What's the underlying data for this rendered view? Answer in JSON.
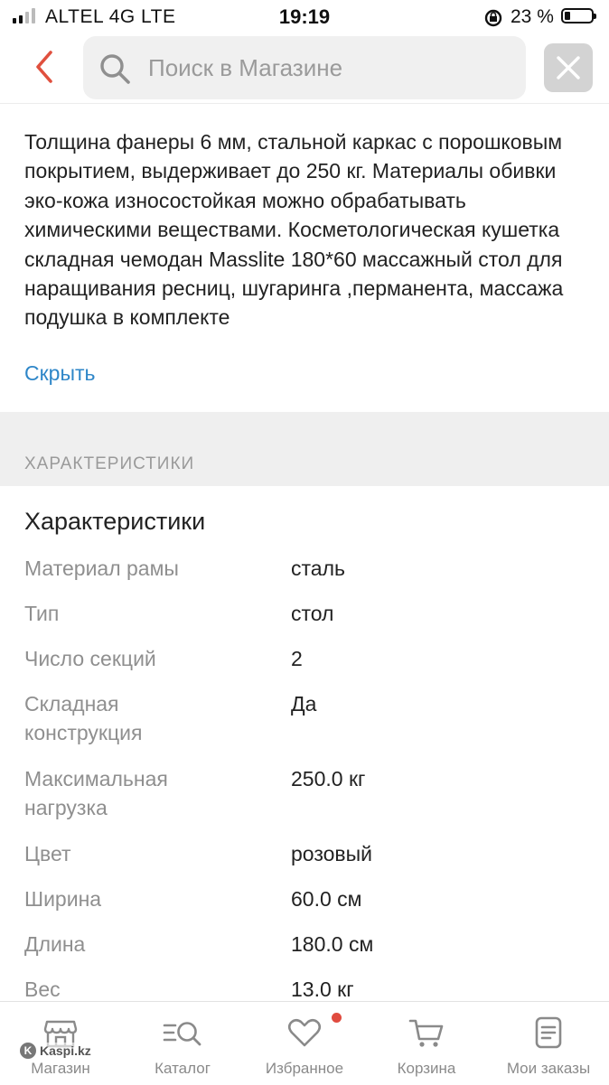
{
  "status_bar": {
    "carrier": "ALTEL 4G  LTE",
    "time": "19:19",
    "battery_percent": "23 %",
    "battery_level": 0.23
  },
  "header": {
    "search_placeholder": "Поиск в Магазине"
  },
  "description": {
    "text": "Толщина фанеры 6 мм, стальной каркас с порошковым покрытием, выдерживает до 250 кг. Материалы обивки эко-кожа износостойкая можно обрабатывать химическими веществами. Косметологическая кушетка складная чемодан Masslite 180*60 массажный стол для наращивания ресниц, шугаринга ,перманента, массажа подушка в комплекте",
    "hide_label": "Скрыть"
  },
  "section": {
    "band_title": "ХАРАКТЕРИСТИКИ",
    "title": "Характеристики",
    "specs": [
      {
        "key": "Материал рамы",
        "value": "сталь"
      },
      {
        "key": "Тип",
        "value": "стол"
      },
      {
        "key": "Число секций",
        "value": "2"
      },
      {
        "key": "Складная конструкция",
        "value": "Да"
      },
      {
        "key": "Максимальная нагрузка",
        "value": "250.0 кг"
      },
      {
        "key": "Цвет",
        "value": "розовый"
      },
      {
        "key": "Ширина",
        "value": "60.0 см"
      },
      {
        "key": "Длина",
        "value": "180.0 см"
      },
      {
        "key": "Вес",
        "value": "13.0 кг"
      }
    ]
  },
  "nav": {
    "items": [
      {
        "label": "Магазин",
        "icon": "shop-icon"
      },
      {
        "label": "Каталог",
        "icon": "catalog-search-icon"
      },
      {
        "label": "Избранное",
        "icon": "heart-icon",
        "badge": true
      },
      {
        "label": "Корзина",
        "icon": "cart-icon"
      },
      {
        "label": "Мои заказы",
        "icon": "orders-icon"
      }
    ]
  },
  "watermark": "Kaspi.kz",
  "colors": {
    "accent_red": "#e04b3f",
    "link_blue": "#2e86c8",
    "back_arrow": "#e0503e"
  }
}
